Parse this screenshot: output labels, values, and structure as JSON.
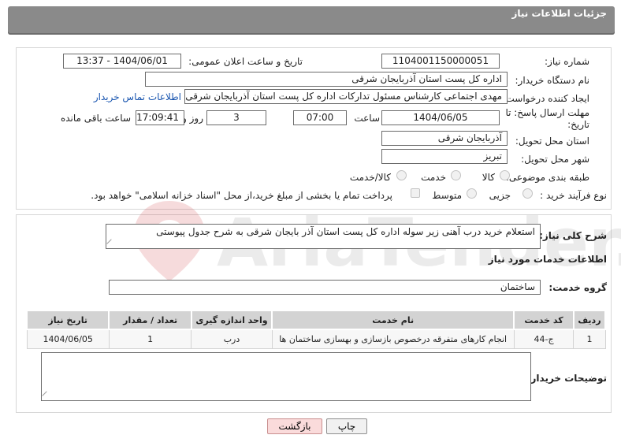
{
  "header": {
    "title": "جزئیات اطلاعات نیاز"
  },
  "form": {
    "need_number_label": "شماره نیاز:",
    "need_number": "1104001150000051",
    "announce_label": "تاریخ و ساعت اعلان عمومی:",
    "announce_value": "1404/06/01 - 13:37",
    "buyer_org_label": "نام دستگاه خریدار:",
    "buyer_org": "اداره کل پست استان آذربایجان شرقی",
    "creator_label": "ایجاد کننده درخواست:",
    "creator": "مهدی اجتماعی کارشناس مسئول تدارکات اداره کل پست استان آذربایجان شرقی",
    "contact_link": "اطلاعات تماس خریدار",
    "deadline_label": "مهلت ارسال پاسخ: تا تاریخ:",
    "deadline_date": "1404/06/05",
    "time_label": "ساعت",
    "deadline_time": "07:00",
    "days_value": "3",
    "days_label": "روز و",
    "remaining_time": "17:09:41",
    "remaining_label": "ساعت باقی مانده",
    "province_label": "استان محل تحویل:",
    "province": "آذربایجان شرقی",
    "city_label": "شهر محل تحویل:",
    "city": "تبریز",
    "category_label": "طبقه بندی موضوعی:",
    "category_options": [
      "کالا",
      "خدمت",
      "کالا/خدمت"
    ],
    "process_label": "نوع فرآیند خرید :",
    "process_options": [
      "جزیی",
      "متوسط"
    ],
    "payment_note": "پرداخت تمام یا بخشی از مبلغ خرید،از محل \"اسناد خزانه اسلامی\" خواهد بود."
  },
  "general": {
    "summary_label": "شرح کلی نیاز:",
    "summary": "استعلام خرید  درب آهنی زیر سوله اداره کل پست استان آذر بایجان شرقی به شرح جدول پیوستی",
    "services_heading": "اطلاعات خدمات مورد نیاز",
    "service_group_label": "گروه خدمت:",
    "service_group": "ساختمان"
  },
  "table": {
    "headers": [
      "ردیف",
      "کد خدمت",
      "نام خدمت",
      "واحد اندازه گیری",
      "تعداد / مقدار",
      "تاریخ نیاز"
    ],
    "rows": [
      [
        "1",
        "ج-44",
        "انجام کارهای متفرقه درخصوص بازسازی و بهسازی ساختمان ها",
        "درب",
        "1",
        "1404/06/05"
      ]
    ]
  },
  "buyer_notes_label": "توضیحات خریدار:",
  "buttons": {
    "print": "چاپ",
    "back": "بازگشت"
  },
  "watermark_text": "AriaTender.neT",
  "colors": {
    "header": "#8a8a8a",
    "link": "#1a56b0",
    "back_button": "#fadbdb"
  }
}
